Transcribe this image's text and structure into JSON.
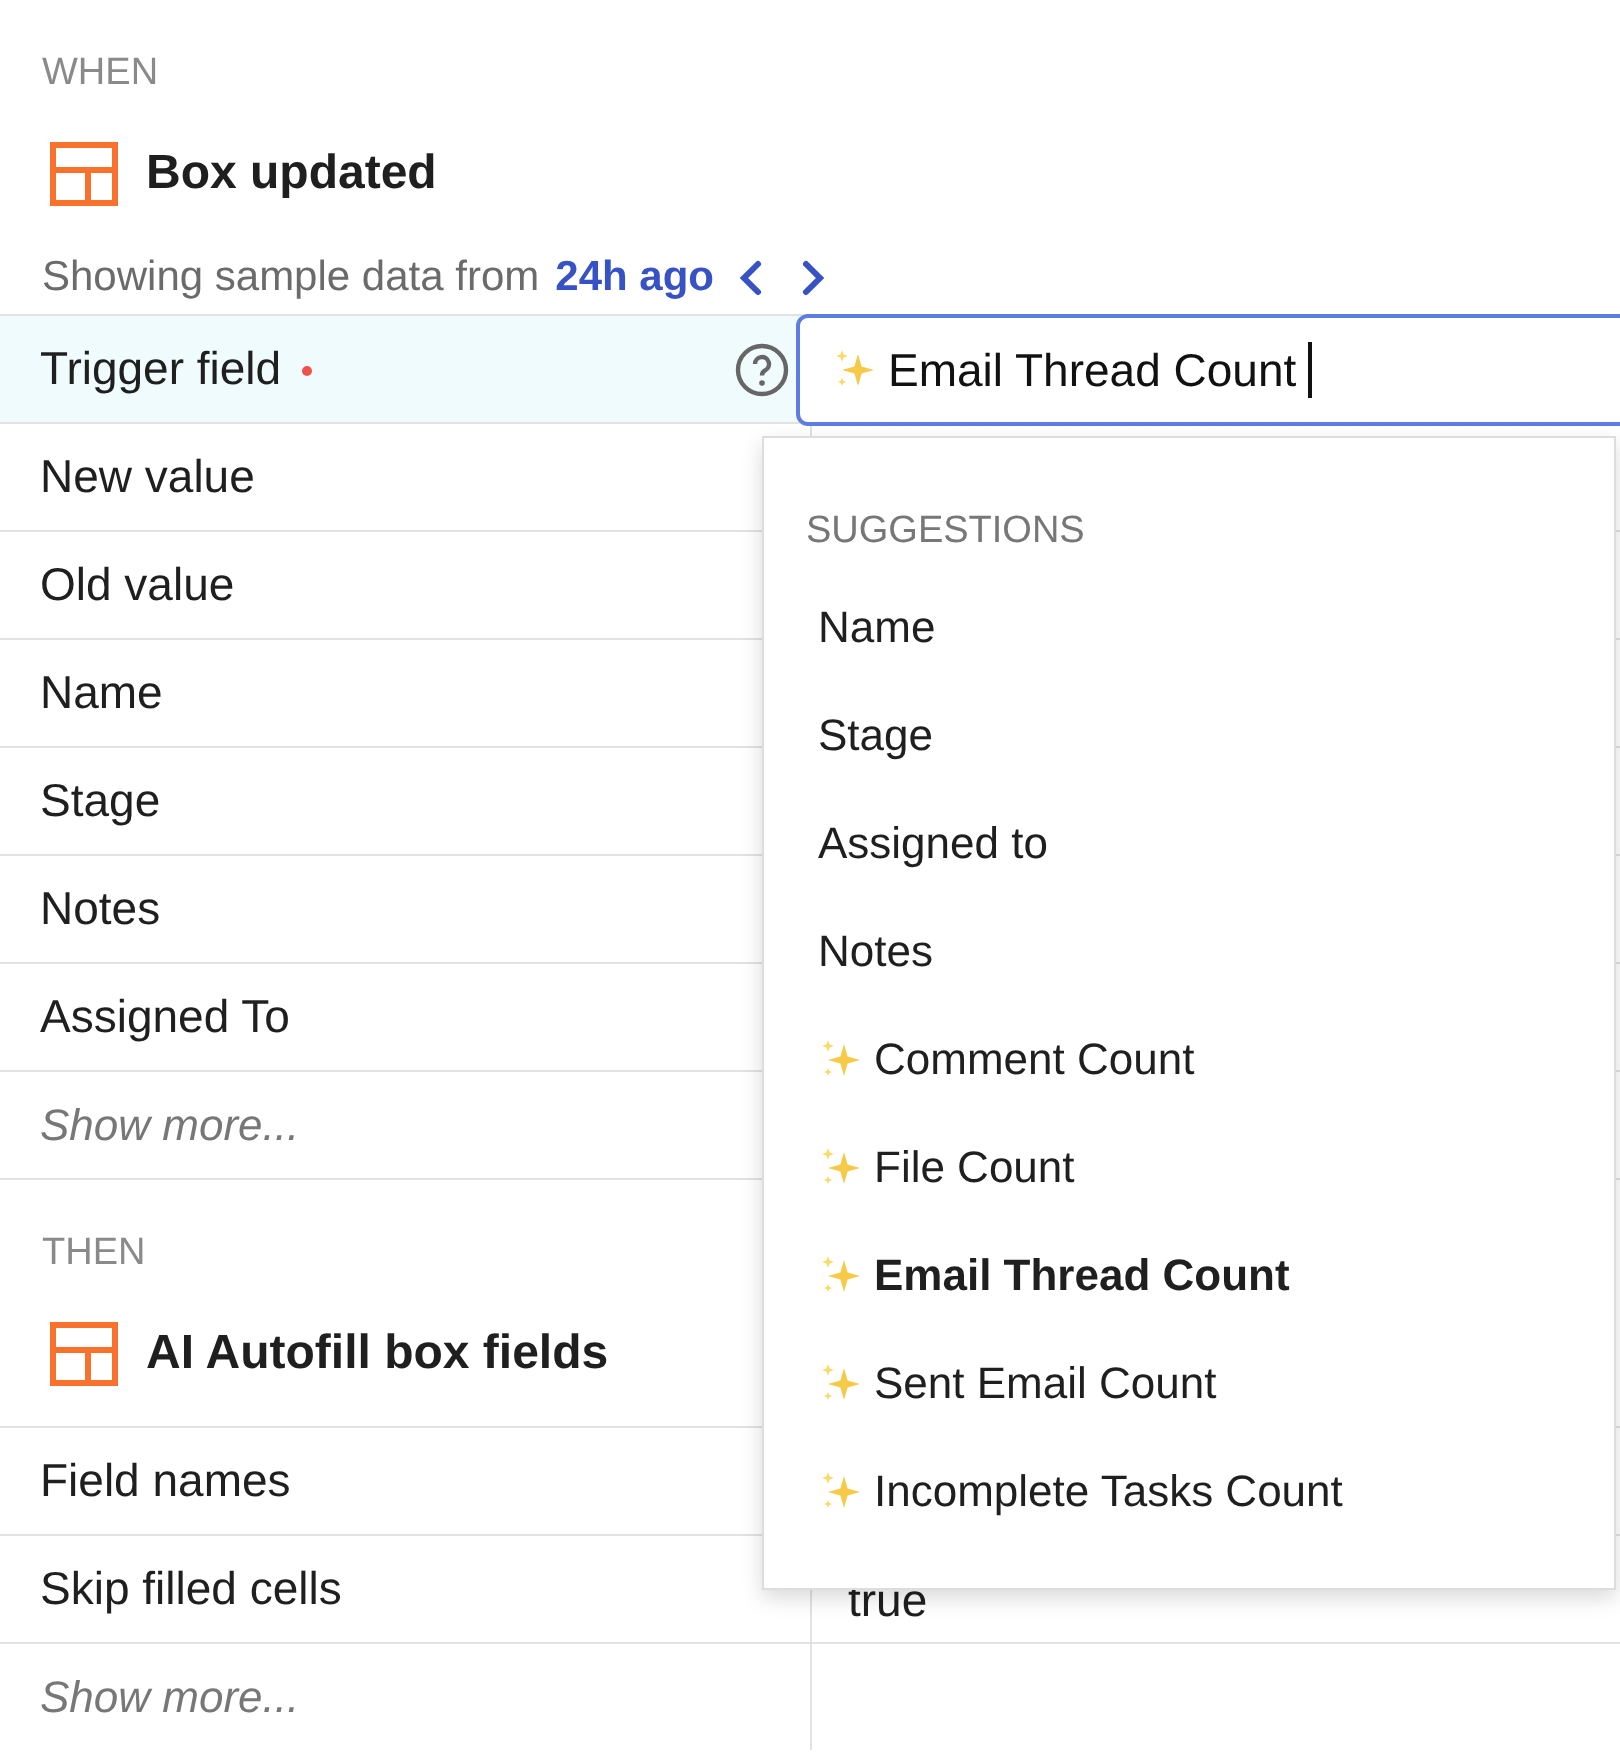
{
  "when": {
    "heading": "WHEN",
    "title": "Box updated",
    "sample_text": "Showing sample data from",
    "sample_link": "24h ago"
  },
  "trigger": {
    "label": "Trigger field",
    "required": true,
    "value": "Email Thread Count",
    "ai": true
  },
  "when_rows": [
    {
      "label": "New value"
    },
    {
      "label": "Old value"
    },
    {
      "label": "Name"
    },
    {
      "label": "Stage"
    },
    {
      "label": "Notes"
    },
    {
      "label": "Assigned To"
    }
  ],
  "when_show_more": "Show more...",
  "then": {
    "heading": "THEN",
    "title": "AI Autofill box fields"
  },
  "then_rows": [
    {
      "label": "Field names"
    },
    {
      "label": "Skip filled cells",
      "value": "true"
    }
  ],
  "then_show_more": "Show more...",
  "suggestions": {
    "heading": "SUGGESTIONS",
    "items": [
      {
        "label": "Name",
        "kind": "plain",
        "selected": false
      },
      {
        "label": "Stage",
        "kind": "plain",
        "selected": false
      },
      {
        "label": "Assigned to",
        "kind": "plain",
        "selected": false
      },
      {
        "label": "Notes",
        "kind": "plain",
        "selected": false
      },
      {
        "label": "Comment Count",
        "kind": "ai",
        "selected": false
      },
      {
        "label": "File Count",
        "kind": "ai",
        "selected": false
      },
      {
        "label": "Email Thread Count",
        "kind": "ai",
        "selected": true
      },
      {
        "label": "Sent Email Count",
        "kind": "ai",
        "selected": false
      },
      {
        "label": "Incomplete Tasks Count",
        "kind": "ai",
        "selected": false
      }
    ]
  }
}
